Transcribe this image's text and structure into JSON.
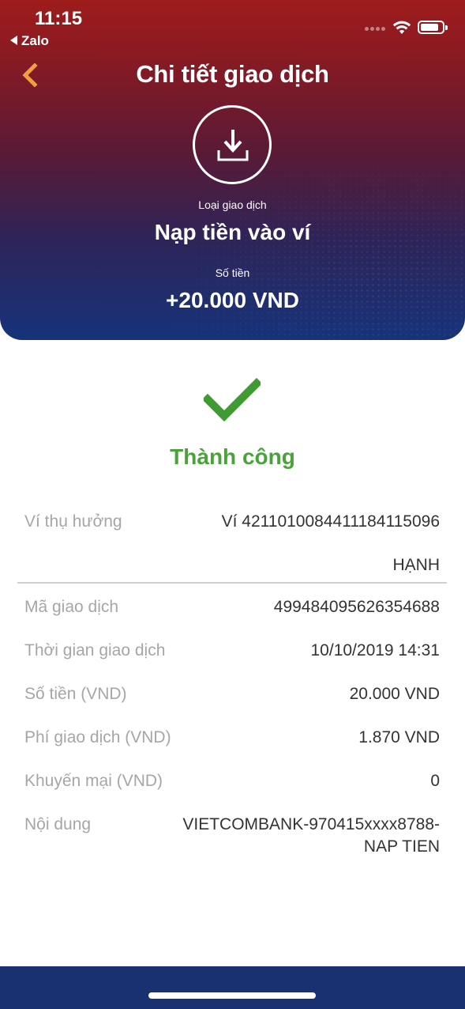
{
  "status_bar": {
    "time": "11:15",
    "back_app": "Zalo"
  },
  "header": {
    "title": "Chi tiết giao dịch",
    "type_label": "Loại giao dịch",
    "type_value": "Nạp tiền vào ví",
    "amount_label": "Số tiền",
    "amount_value": "+20.000 VND"
  },
  "result": {
    "status": "Thành công",
    "status_color": "#4aa33a"
  },
  "details": [
    {
      "label": "Ví thụ hưởng",
      "value_line1": "Ví 4211010084411184115096",
      "value_line2": "HẠNH"
    },
    {
      "label": "Mã giao dịch",
      "value": "499484095626354688"
    },
    {
      "label": "Thời gian giao dịch",
      "value": "10/10/2019 14:31"
    },
    {
      "label": "Số tiền (VND)",
      "value": "20.000 VND"
    },
    {
      "label": "Phí giao dịch (VND)",
      "value": "1.870 VND"
    },
    {
      "label": "Khuyến mại (VND)",
      "value": "0"
    },
    {
      "label": "Nội dung",
      "value_line1": "VIETCOMBANK-970415xxxx8788-",
      "value_line2": "NAP TIEN"
    }
  ],
  "colors": {
    "accent_back": "#f0a040",
    "header_top": "#9e1c1c",
    "header_bottom": "#16337a",
    "bottom_bar": "#193170"
  }
}
